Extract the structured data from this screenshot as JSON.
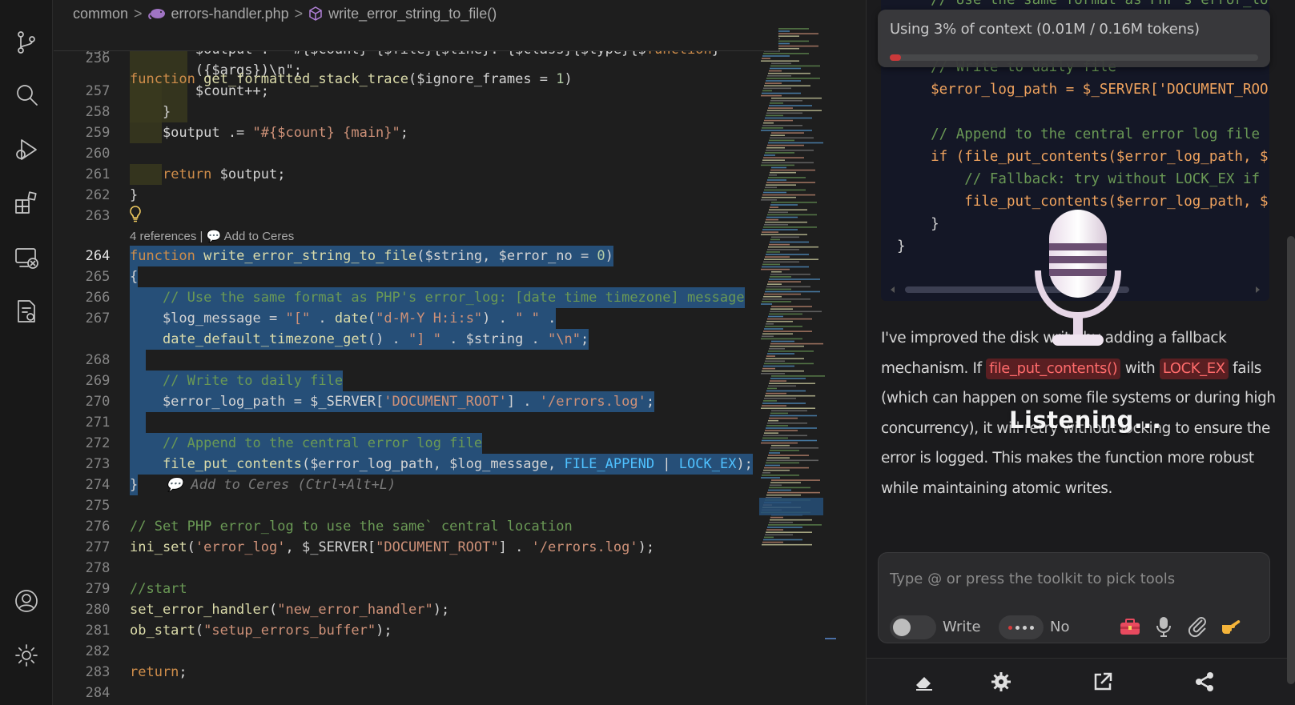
{
  "breadcrumb": {
    "folder": "common",
    "file": "errors-handler.php",
    "symbol": "write_error_string_to_file()"
  },
  "editor": {
    "sticky_line_number": "236",
    "sticky_line": [
      "function",
      " ",
      "get_formatted_stack_trace",
      "(",
      "$ignore_frames",
      " = ",
      "1",
      ")"
    ],
    "codelens": "4 references | ",
    "codelens_action": "Add to Ceres",
    "ghost_hint": "Add to Ceres (Ctrl+Alt+L)",
    "lines": [
      {
        "n": "256",
        "text": "        $output .= \"#{$count} {$file}{$line}: {$class}{$type}{$function}"
      },
      {
        "n": "",
        "text": "        ({$args})\\n\";"
      },
      {
        "n": "257",
        "text": "        $count++;"
      },
      {
        "n": "258",
        "text": "    }"
      },
      {
        "n": "259",
        "text": "    $output .= \"#{$count} {main}\";"
      },
      {
        "n": "260",
        "text": ""
      },
      {
        "n": "261",
        "text": "    return $output;"
      },
      {
        "n": "262",
        "text": "}"
      },
      {
        "n": "263",
        "text": ""
      },
      {
        "n": "264",
        "text": "function write_error_string_to_file($string, $error_no = 0)"
      },
      {
        "n": "265",
        "text": "{"
      },
      {
        "n": "266",
        "text": "    // Use the same format as PHP's error_log: [date time timezone] message"
      },
      {
        "n": "267",
        "text": "    $log_message = \"[\" . date(\"d-M-Y H:i:s\") . \" \" ."
      },
      {
        "n": "",
        "text": "    date_default_timezone_get() . \"] \" . $string . \"\\n\";"
      },
      {
        "n": "268",
        "text": ""
      },
      {
        "n": "269",
        "text": "    // Write to daily file"
      },
      {
        "n": "270",
        "text": "    $error_log_path = $_SERVER['DOCUMENT_ROOT'] . '/errors.log';"
      },
      {
        "n": "271",
        "text": ""
      },
      {
        "n": "272",
        "text": "    // Append to the central error log file"
      },
      {
        "n": "273",
        "text": "    file_put_contents($error_log_path, $log_message, FILE_APPEND | LOCK_EX);"
      },
      {
        "n": "274",
        "text": "}"
      },
      {
        "n": "275",
        "text": ""
      },
      {
        "n": "276",
        "text": "// Set PHP error_log to use the same` central location"
      },
      {
        "n": "277",
        "text": "ini_set('error_log', $_SERVER[\"DOCUMENT_ROOT\"] . '/errors.log');"
      },
      {
        "n": "278",
        "text": ""
      },
      {
        "n": "279",
        "text": "//start"
      },
      {
        "n": "280",
        "text": "set_error_handler(\"new_error_handler\");"
      },
      {
        "n": "281",
        "text": "ob_start(\"setup_errors_buffer\");"
      },
      {
        "n": "282",
        "text": ""
      },
      {
        "n": "283",
        "text": "return;"
      },
      {
        "n": "284",
        "text": ""
      }
    ]
  },
  "panel": {
    "context": "Using 3% of context (0.01M / 0.16M tokens)",
    "context_fraction": 0.03,
    "code_lines": [
      "    // Use the same format as PHP's error_lo",
      "",
      "    // Write to daily file",
      "    $error_log_path = $_SERVER['DOCUMENT_ROO",
      "",
      "    // Append to the central error log file",
      "    if (file_put_contents($error_log_path, $",
      "        // Fallback: try without LOCK_EX if",
      "        file_put_contents($error_log_path, $",
      "    }",
      "}"
    ],
    "message": {
      "p1": "I've improved the disk write by adding a fallback mechanism. If ",
      "tag1": "file_put_contents()",
      "p2": " with ",
      "tag2": "LOCK_EX",
      "p3": " fails (which can happen on some file systems or during high concurrency), it will retry without locking to ensure the error is logged. This makes the function more robust while maintaining atomic writes."
    },
    "listening": "Listening...",
    "composer_placeholder": "Type @ or press the toolkit to pick tools",
    "write_label": "Write",
    "no_label": "No"
  },
  "colors": {
    "selection": "#264f78",
    "accent_red": "#d23b3b",
    "editor_bg": "#1e1e1e"
  },
  "icons": [
    "source-control-icon",
    "search-icon",
    "run-debug-icon",
    "extensions-icon",
    "remote-explorer-icon",
    "notes-icon",
    "account-icon",
    "settings-gear-icon",
    "microphone-icon",
    "eraser-icon",
    "gear-icon",
    "external-link-icon",
    "share-icon",
    "toolbox-icon",
    "attach-icon",
    "pointing-hand-icon"
  ]
}
